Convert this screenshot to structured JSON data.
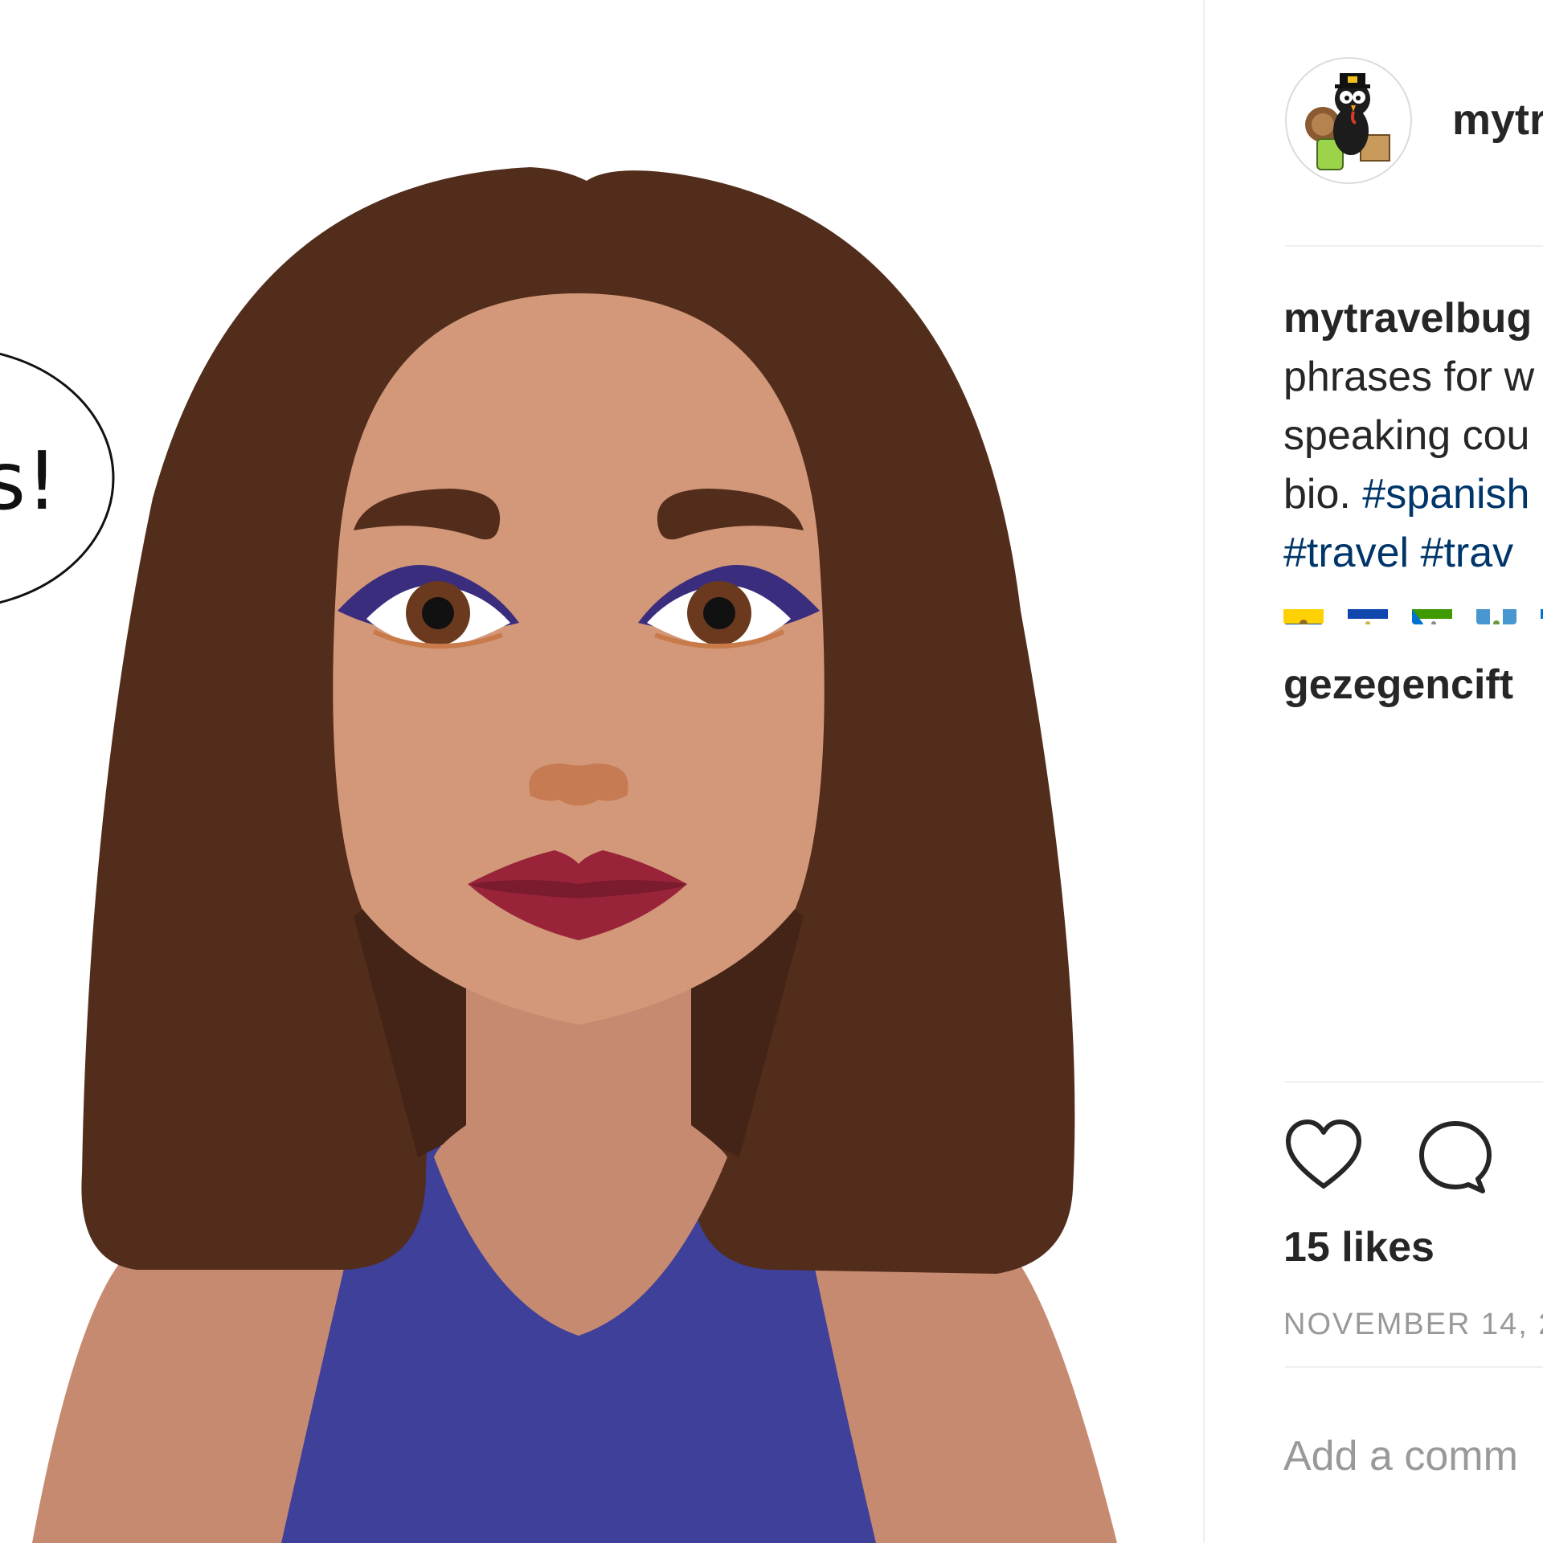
{
  "post": {
    "speech_bubble_text": "s!",
    "skin_color": "#d29879",
    "hair_color": "#532d1b",
    "top_color": "#3e409a",
    "lip_color": "#99243a"
  },
  "header": {
    "avatar_icon": "turkey-traveler-avatar",
    "username": "mytr"
  },
  "caption": {
    "username": "mytravelbug",
    "line2": "phrases for w",
    "line3": "speaking cou",
    "line4_text": "bio. ",
    "line4_tag": "#spanish",
    "tag1": "#travel",
    "tag2": "#trav",
    "flags": [
      "flag-ecuador",
      "flag-el-salvador",
      "flag-equatorial-guinea",
      "flag-guatemala",
      "flag-honduras"
    ]
  },
  "comments": [
    {
      "username": "gezegencift"
    }
  ],
  "actions": {
    "like_icon": "heart-icon",
    "comment_icon": "comment-icon"
  },
  "likes": "15 likes",
  "date": "NOVEMBER 14, 2",
  "add_comment_placeholder": "Add a comm",
  "colors": {
    "text": "#262626",
    "hashtag": "#003569",
    "muted": "#999999",
    "divider": "#efefef"
  }
}
